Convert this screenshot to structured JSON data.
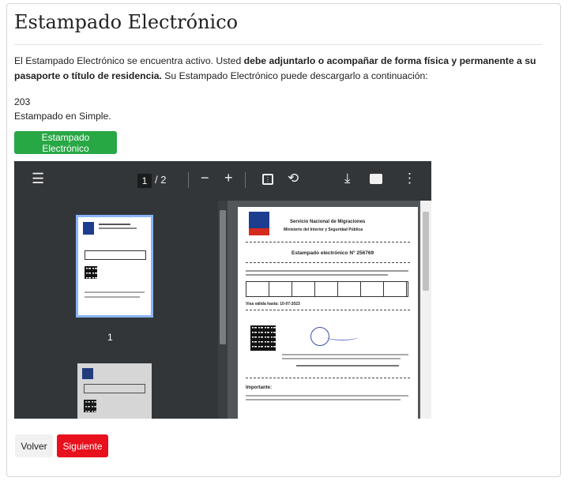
{
  "page": {
    "title": "Estampado Electrónico",
    "intro_normal_1": "El Estampado Electrónico se encuentra activo. Usted ",
    "intro_bold": "debe adjuntarlo o acompañar de forma física y permanente a su pasaporte o título de residencia.",
    "intro_normal_2": " Su Estampado Electrónico puede descargarlo a continuación:",
    "code": "203",
    "status": "Estampado en Simple.",
    "download_button": "Estampado Electrónico"
  },
  "pdf_viewer": {
    "current_page": "1",
    "page_separator": "/",
    "total_pages": "2",
    "thumbnail_label": "1",
    "icons": [
      "menu-icon",
      "zoom-out-icon",
      "zoom-in-icon",
      "fit-page-icon",
      "rotate-icon",
      "download-icon",
      "print-icon",
      "more-icon"
    ],
    "document": {
      "org_name": "Servicio Nacional de Migraciones",
      "ministry": "Ministerio del Interior y Seguridad Pública",
      "heading": "Estampado electrónico N° 256769",
      "validity_label": "Visa válida hasta: 10-07-2023",
      "notice_title": "Importante:"
    }
  },
  "footer": {
    "back_button": "Volver",
    "next_button": "Siguiente"
  },
  "colors": {
    "green": "#28a745",
    "red": "#e8101d",
    "toolbar": "#323639"
  }
}
